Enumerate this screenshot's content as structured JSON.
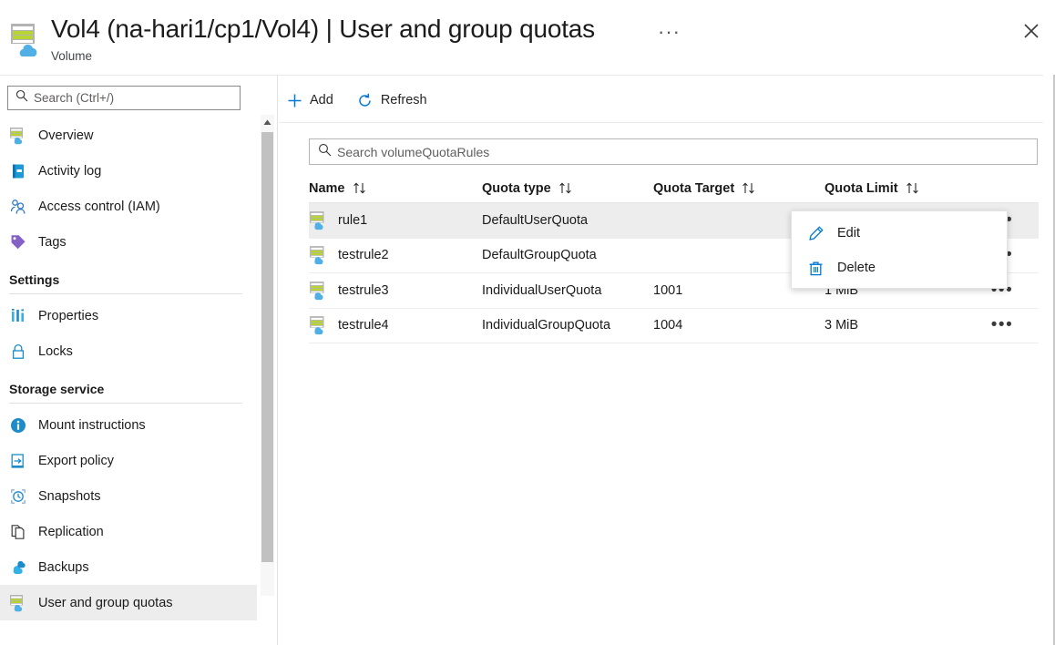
{
  "header": {
    "title": "Vol4 (na-hari1/cp1/Vol4) | User and group quotas",
    "subtitle": "Volume",
    "more_label": "···",
    "close_icon": "close-icon",
    "resource_icon": "volume-icon"
  },
  "sidebar": {
    "search": {
      "placeholder": "Search (Ctrl+/)",
      "value": "",
      "icon": "search-icon"
    },
    "collapse_icon": "chevron-double-left-icon",
    "items": [
      {
        "label": "Overview",
        "icon": "volume-icon",
        "selected": false
      },
      {
        "label": "Activity log",
        "icon": "activity-log-icon",
        "selected": false
      },
      {
        "label": "Access control (IAM)",
        "icon": "people-icon",
        "selected": false
      },
      {
        "label": "Tags",
        "icon": "tag-icon",
        "selected": false
      }
    ],
    "groups": [
      {
        "label": "Settings",
        "items": [
          {
            "label": "Properties",
            "icon": "properties-icon",
            "selected": false
          },
          {
            "label": "Locks",
            "icon": "lock-icon",
            "selected": false
          }
        ]
      },
      {
        "label": "Storage service",
        "items": [
          {
            "label": "Mount instructions",
            "icon": "info-icon",
            "selected": false
          },
          {
            "label": "Export policy",
            "icon": "export-icon",
            "selected": false
          },
          {
            "label": "Snapshots",
            "icon": "snapshot-icon",
            "selected": false
          },
          {
            "label": "Replication",
            "icon": "replication-icon",
            "selected": false
          },
          {
            "label": "Backups",
            "icon": "backup-icon",
            "selected": false
          },
          {
            "label": "User and group quotas",
            "icon": "volume-icon",
            "selected": true
          }
        ]
      }
    ]
  },
  "toolbar": {
    "add_label": "Add",
    "add_icon": "plus-icon",
    "refresh_label": "Refresh",
    "refresh_icon": "refresh-icon"
  },
  "filter": {
    "placeholder": "Search volumeQuotaRules",
    "value": "",
    "icon": "search-icon"
  },
  "table": {
    "columns": [
      {
        "label": "Name",
        "sort_icon": "sort-icon"
      },
      {
        "label": "Quota type",
        "sort_icon": "sort-icon"
      },
      {
        "label": "Quota Target",
        "sort_icon": "sort-icon"
      },
      {
        "label": "Quota Limit",
        "sort_icon": "sort-icon"
      }
    ],
    "row_menu_icon": "ellipsis-icon",
    "row_icon": "volume-icon",
    "rows": [
      {
        "name": "rule1",
        "type": "DefaultUserQuota",
        "target": "",
        "limit": "",
        "hovered": true
      },
      {
        "name": "testrule2",
        "type": "DefaultGroupQuota",
        "target": "",
        "limit": "",
        "hovered": false
      },
      {
        "name": "testrule3",
        "type": "IndividualUserQuota",
        "target": "1001",
        "limit": "1 MiB",
        "hovered": false
      },
      {
        "name": "testrule4",
        "type": "IndividualGroupQuota",
        "target": "1004",
        "limit": "3 MiB",
        "hovered": false
      }
    ]
  },
  "context_menu": {
    "items": [
      {
        "label": "Edit",
        "icon": "pencil-icon"
      },
      {
        "label": "Delete",
        "icon": "trash-icon"
      }
    ]
  },
  "colors": {
    "accent": "#0078d4",
    "selected_row": "#ededed",
    "text": "#1b1b1b",
    "border": "#e6e6e6"
  }
}
